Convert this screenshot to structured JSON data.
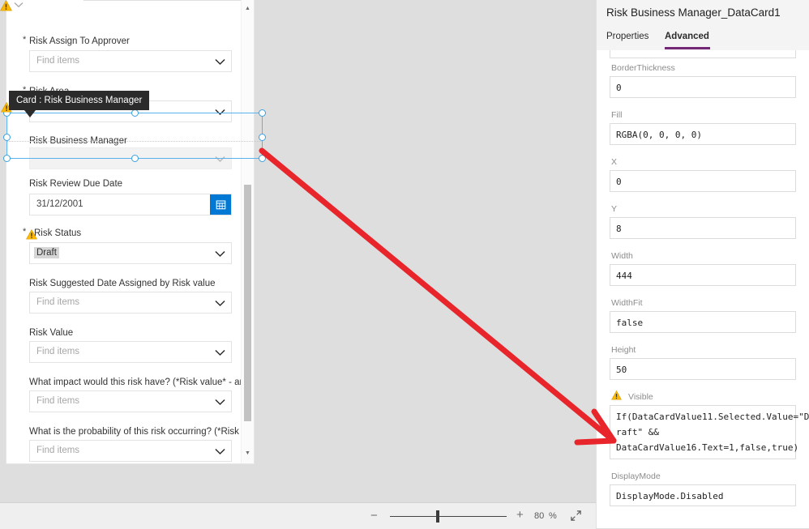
{
  "app": {
    "canvas_bg": "#dedede",
    "accent_blue": "#0078d4",
    "accent_purple": "#742774",
    "selection_blue": "#3c9fe0",
    "annotation_red": "#e8252a",
    "warning_yellow": "#ffb900"
  },
  "tooltip": {
    "text": "Card : Risk Business Manager"
  },
  "form": {
    "fields": [
      {
        "label": "Risk Assign To Approver",
        "required": true,
        "warn": false,
        "value": "",
        "placeholder": "Find items",
        "control": "dropdown",
        "dim": false
      },
      {
        "label": "Risk Area",
        "required": true,
        "warn": false,
        "value": "",
        "placeholder": "",
        "control": "dropdown",
        "dim": false
      },
      {
        "label": "Risk Business Manager",
        "required": false,
        "warn": false,
        "value": "",
        "placeholder": "",
        "control": "dropdown",
        "dim": true
      },
      {
        "label": "Risk Review Due Date",
        "required": false,
        "warn": false,
        "value": "31/12/2001",
        "placeholder": "",
        "control": "date",
        "dim": false
      },
      {
        "label": "Risk Status",
        "required": true,
        "warn": true,
        "value": "Draft",
        "placeholder": "",
        "control": "dropdown-selected",
        "dim": false
      },
      {
        "label": "Risk Suggested Date Assigned by Risk value",
        "required": false,
        "warn": false,
        "value": "",
        "placeholder": "Find items",
        "control": "dropdown",
        "dim": false
      },
      {
        "label": "Risk Value",
        "required": false,
        "warn": false,
        "value": "",
        "placeholder": "Find items",
        "control": "dropdown",
        "dim": false
      },
      {
        "label": "What impact would this risk have?  (*Risk value* - answer)",
        "required": false,
        "warn": false,
        "value": "",
        "placeholder": "Find items",
        "control": "dropdown",
        "dim": false
      },
      {
        "label": "What is the probability of this risk occurring? (*Risk value…",
        "required": false,
        "warn": false,
        "value": "",
        "placeholder": "Find items",
        "control": "dropdown",
        "dim": false
      }
    ]
  },
  "zoombar": {
    "minus": "−",
    "plus": "+",
    "percent": "80",
    "percent_symbol": "%",
    "fit_icon": "fit-to-screen-icon"
  },
  "properties_panel": {
    "title": "Risk Business Manager_DataCard1",
    "tabs": [
      {
        "label": "Properties",
        "active": false
      },
      {
        "label": "Advanced",
        "active": true
      }
    ],
    "items": [
      {
        "label": "BorderThickness",
        "value": "0",
        "warn": false,
        "lines": 1
      },
      {
        "label": "Fill",
        "value": "RGBA(0, 0, 0, 0)",
        "warn": false,
        "lines": 1
      },
      {
        "label": "X",
        "value": "0",
        "warn": false,
        "lines": 1
      },
      {
        "label": "Y",
        "value": "8",
        "warn": false,
        "lines": 1
      },
      {
        "label": "Width",
        "value": "444",
        "warn": false,
        "lines": 1
      },
      {
        "label": "WidthFit",
        "value": "false",
        "warn": false,
        "lines": 1
      },
      {
        "label": "Height",
        "value": "50",
        "warn": false,
        "lines": 1
      },
      {
        "label": "Visible",
        "value": "If(DataCardValue11.Selected.Value=\"D\nraft\" &&\nDataCardValue16.Text=1,false,true)",
        "warn": true,
        "lines": 3
      },
      {
        "label": "DisplayMode",
        "value": "DisplayMode.Disabled",
        "warn": false,
        "lines": 1
      }
    ]
  }
}
